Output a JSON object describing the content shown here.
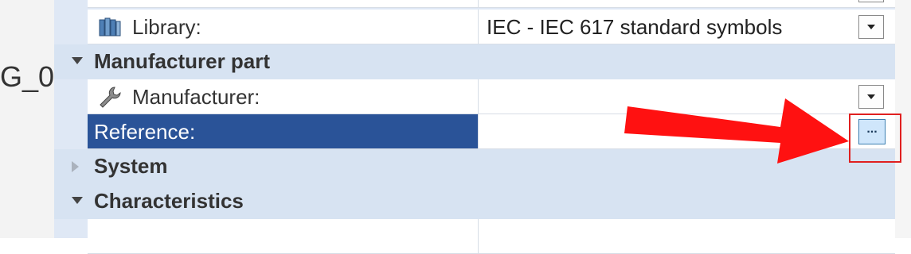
{
  "fragment_text": "G_0",
  "rows": {
    "library": {
      "label": "Library:",
      "value": "IEC - IEC 617 standard symbols"
    },
    "manufacturer_part_group": {
      "label": "Manufacturer part"
    },
    "manufacturer": {
      "label": "Manufacturer:",
      "value": ""
    },
    "reference": {
      "label": "Reference:",
      "value": "",
      "button_label": "..."
    },
    "system_group": {
      "label": "System"
    },
    "characteristics_group": {
      "label": "Characteristics"
    }
  },
  "icons": {
    "library": "library-books-icon",
    "manufacturer": "wrench-icon",
    "expand_open": "triangle-down-icon",
    "expand_closed": "triangle-right-icon",
    "dropdown": "chevron-down-icon"
  },
  "colors": {
    "panel_bg": "#dfe8f5",
    "group_bg": "#d7e3f2",
    "selected_bg": "#2a5398",
    "annotation_red": "#e02020",
    "button_bg": "#cfe6fb"
  }
}
